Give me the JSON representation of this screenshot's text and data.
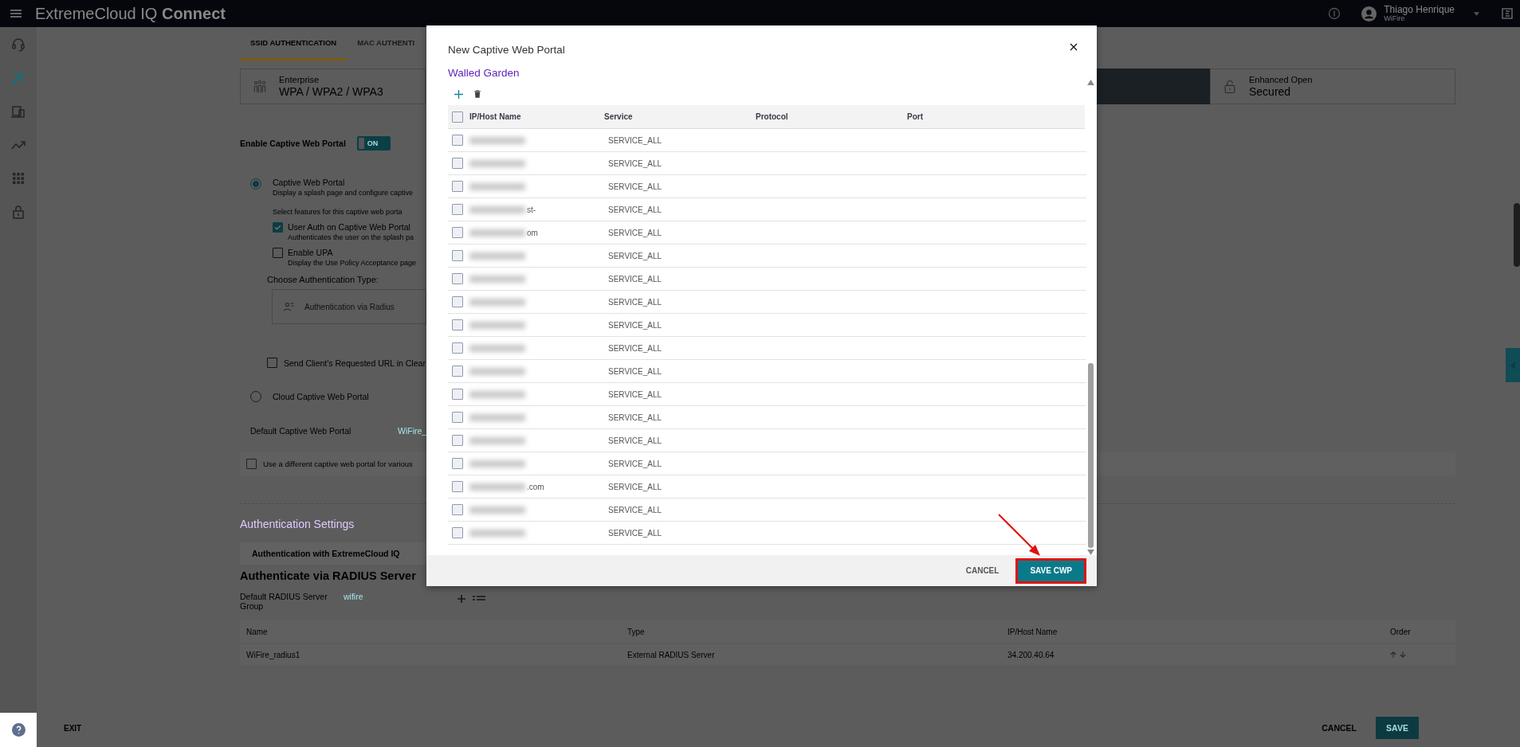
{
  "top_bar": {
    "app_name": "ExtremeCloud IQ **Connect**",
    "user_name": "Thiago Henrique",
    "user_org": "WiFire"
  },
  "sidebar": {
    "items": [
      {
        "kind": "support",
        "selected": false
      },
      {
        "kind": "configure",
        "selected": true
      },
      {
        "kind": "devices",
        "selected": false
      },
      {
        "kind": "monitor",
        "selected": false
      },
      {
        "kind": "apps",
        "selected": false
      },
      {
        "kind": "security",
        "selected": false
      }
    ]
  },
  "tabs": [
    {
      "label": "SSID AUTHENTICATION",
      "selected": true
    },
    {
      "label": "MAC AUTHENTI",
      "selected": false
    }
  ],
  "auth_types": [
    {
      "kind": "enterprise",
      "title": "Enterprise",
      "subtitle": "WPA / WPA2 / WPA3",
      "selected": false
    },
    {
      "kind": "hidden",
      "selected": true
    },
    {
      "kind": "open",
      "title": "Enhanced Open",
      "subtitle": "Secured",
      "selected": false
    }
  ],
  "captive_portal": {
    "enable_label": "Enable Captive Web Portal",
    "toggle": {
      "label": "ON",
      "on": true
    },
    "cwp_option": {
      "label": "Captive Web Portal",
      "description": "Display a splash page and configure captive",
      "selected": true
    },
    "features_label": "Select features for this captive web porta",
    "features": [
      {
        "label": "User Auth on Captive Web Portal",
        "description": "Authenticates the user on the splash pa",
        "checked": true
      },
      {
        "label": "Enable UPA",
        "description": "Display the Use Policy Acceptance page",
        "checked": false
      }
    ],
    "auth_type_label": "Choose Authentication Type:",
    "auth_type_card": "Authentication via Radius",
    "send_url": {
      "label": "Send Client's Requested URL in Clear",
      "checked": false
    },
    "cloud_option": {
      "label": "Cloud Captive Web Portal",
      "selected": false
    },
    "default_cwp": {
      "label": "Default Captive Web Portal",
      "value": "WiFire_"
    },
    "different_cwp": {
      "label": "Use a different captive web portal for various",
      "checked": false
    }
  },
  "auth_settings": {
    "title": "Authentication Settings",
    "tab": "Authentication with ExtremeCloud IQ",
    "heading": "Authenticate via RADIUS Server",
    "group_label": "Default RADIUS Server Group",
    "group_value": "wifire",
    "table": {
      "columns": [
        "Name",
        "Type",
        "IP/Host Name",
        "Order"
      ],
      "rows": [
        [
          "WiFire_radius1",
          "External RADIUS Server",
          "34.200.40.64"
        ]
      ]
    }
  },
  "footer": {
    "exit": "EXIT",
    "cancel": "CANCEL",
    "save": "SAVE"
  },
  "modal": {
    "title": "New Captive Web Portal",
    "section": "Walled Garden",
    "table": {
      "columns": [
        "IP/Host Name",
        "Service",
        "Protocol",
        "Port"
      ],
      "header_checked": false,
      "rows": [
        {
          "service": "SERVICE_ALL",
          "checked": false
        },
        {
          "service": "SERVICE_ALL",
          "checked": false
        },
        {
          "service": "SERVICE_ALL",
          "checked": false
        },
        {
          "host": "st-",
          "service": "SERVICE_ALL",
          "checked": false
        },
        {
          "host": "om",
          "service": "SERVICE_ALL",
          "checked": false
        },
        {
          "service": "SERVICE_ALL",
          "checked": false
        },
        {
          "service": "SERVICE_ALL",
          "checked": false
        },
        {
          "service": "SERVICE_ALL",
          "checked": false
        },
        {
          "service": "SERVICE_ALL",
          "checked": false
        },
        {
          "service": "SERVICE_ALL",
          "checked": false
        },
        {
          "service": "SERVICE_ALL",
          "checked": false
        },
        {
          "service": "SERVICE_ALL",
          "checked": false
        },
        {
          "service": "SERVICE_ALL",
          "checked": false
        },
        {
          "service": "SERVICE_ALL",
          "checked": false
        },
        {
          "service": "SERVICE_ALL",
          "checked": false
        },
        {
          "host": ".com",
          "service": "SERVICE_ALL",
          "checked": false
        },
        {
          "service": "SERVICE_ALL",
          "checked": false
        },
        {
          "service": "SERVICE_ALL",
          "checked": false
        }
      ]
    },
    "cancel": "CANCEL",
    "save": "SAVE CWP"
  }
}
